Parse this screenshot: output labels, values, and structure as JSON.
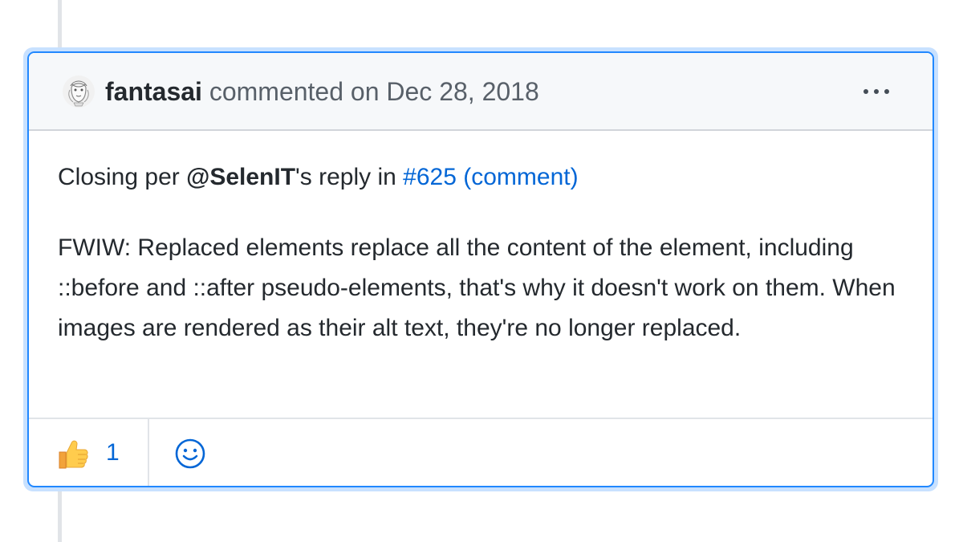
{
  "comment": {
    "author": "fantasai",
    "action": "commented on",
    "date": "Dec 28, 2018",
    "body": {
      "line1_prefix": "Closing per ",
      "mention": "@SelenIT",
      "line1_middle": "'s reply in ",
      "issue_link": "#625",
      "comment_link": "(comment)",
      "paragraph2": "FWIW: Replaced elements replace all the content of the element, including ::before and ::after pseudo-elements, that's why it doesn't work on them. When images are rendered as their alt text, they're no longer replaced."
    },
    "reactions": [
      {
        "icon": "thumbs-up-icon",
        "emoji": "👍",
        "count": "1"
      }
    ],
    "add_reaction_icon": "smiley-icon"
  },
  "colors": {
    "accent_border": "#2188ff",
    "outer_glow": "#c8e1ff",
    "link": "#0366d6",
    "header_bg": "#f6f8fa",
    "text": "#24292e",
    "muted": "#586069"
  }
}
